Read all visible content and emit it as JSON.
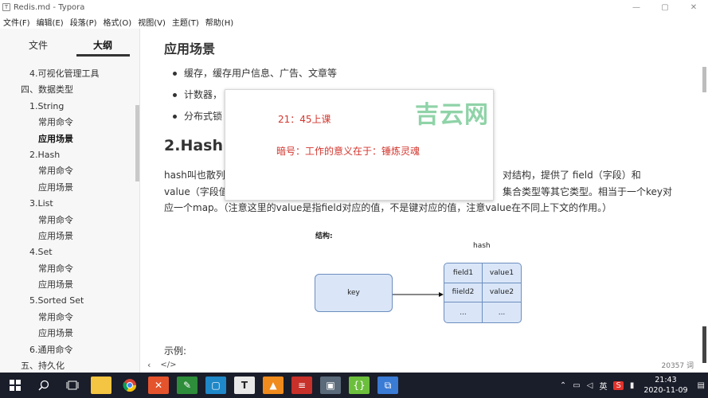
{
  "window": {
    "title": "Redis.md - Typora",
    "app_icon": "T",
    "controls": [
      "—",
      "▢",
      "✕"
    ]
  },
  "menu": [
    "文件(F)",
    "编辑(E)",
    "段落(P)",
    "格式(O)",
    "视图(V)",
    "主题(T)",
    "帮助(H)"
  ],
  "sidebar": {
    "tab_files": "文件",
    "tab_outline": "大纲",
    "outline": [
      {
        "text": "4.可视化管理工具",
        "indent": 1
      },
      {
        "text": "四、数据类型",
        "indent": 0
      },
      {
        "text": "1.String",
        "indent": 1
      },
      {
        "text": "常用命令",
        "indent": 2
      },
      {
        "text": "应用场景",
        "indent": 2,
        "active": true
      },
      {
        "text": "2.Hash",
        "indent": 1
      },
      {
        "text": "常用命令",
        "indent": 2
      },
      {
        "text": "应用场景",
        "indent": 2
      },
      {
        "text": "3.List",
        "indent": 1
      },
      {
        "text": "常用命令",
        "indent": 2
      },
      {
        "text": "应用场景",
        "indent": 2
      },
      {
        "text": "4.Set",
        "indent": 1
      },
      {
        "text": "常用命令",
        "indent": 2
      },
      {
        "text": "应用场景",
        "indent": 2
      },
      {
        "text": "5.Sorted Set",
        "indent": 1
      },
      {
        "text": "常用命令",
        "indent": 2
      },
      {
        "text": "应用场景",
        "indent": 2
      },
      {
        "text": "6.通用命令",
        "indent": 1
      },
      {
        "text": "五、持久化",
        "indent": 0
      }
    ]
  },
  "editor": {
    "heading_scene": "应用场景",
    "bullets": [
      "缓存，缓存用户信息、广告、文章等",
      "计数器，",
      "分布式锁"
    ],
    "heading_hash": "2.Hash",
    "para_line1_left": "hash叫也散列",
    "para_line1_right": "对结构，提供了 field（字段）和",
    "para_line2_left": "value（字段值",
    "para_line2_right": "集合类型等其它类型。相当于一个key对",
    "para_line3": "应一个map。（注意这里的value是指field对应的值，不是键对应的值，注意value在不同上下文的作用。）",
    "diagram": {
      "structure_label": "结构:",
      "hash_label": "hash",
      "key_label": "key",
      "cells": [
        "field1",
        "value1",
        "fiield2",
        "value2",
        "...",
        "..."
      ]
    },
    "example_label": "示例:"
  },
  "status": {
    "nav_icon": "‹",
    "source_icon": "</>",
    "word_count": "20357 词"
  },
  "popup": {
    "time_line": "21：45上课",
    "code_line": "暗号：工作的意义在于：锤炼灵魂",
    "watermark": "吉云网"
  },
  "taskbar": {
    "ime": "英",
    "time": "21:43",
    "date": "2020-11-09"
  }
}
